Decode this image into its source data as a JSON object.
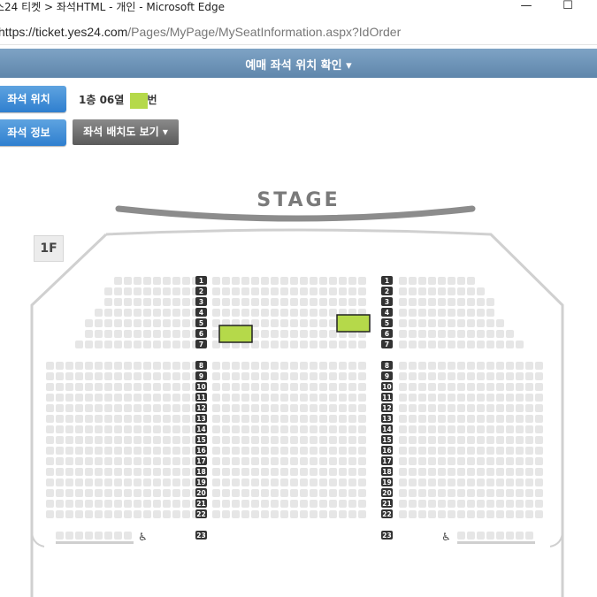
{
  "window": {
    "title": "스24 티켓 > 좌석HTML - 개인 - Microsoft Edge",
    "minimize_glyph": "—",
    "maximize_glyph": "☐"
  },
  "address": {
    "url_host": "https://ticket.yes24.com",
    "url_path": "/Pages/MyPage/MySeatInformation.aspx?IdOrder"
  },
  "header": {
    "title": "예매 좌석 위치 확인 ▾"
  },
  "buttons": {
    "seat_location": "좌석 위치",
    "seat_info": "좌석 정보",
    "seat_map": "좌석 배치도 보기 ▾"
  },
  "seat": {
    "floor_row": "1층 06열",
    "suffix": "번"
  },
  "map": {
    "stage_label": "STAGE",
    "floor_label": "1F",
    "row_numbers_upper": [
      "1",
      "2",
      "3",
      "4",
      "5",
      "6",
      "7"
    ],
    "row_numbers_lower": [
      "8",
      "9",
      "10",
      "11",
      "12",
      "13",
      "14",
      "15",
      "16",
      "17",
      "18",
      "19",
      "20",
      "21",
      "22"
    ],
    "row_number_last": "23",
    "wheelchair_icon": "wheelchair-icon",
    "colors": {
      "seat": "#e6e6e6",
      "highlight": "#b5d94a",
      "badge": "#333333",
      "outline": "#d0d0d0"
    },
    "highlighted_seats": [
      {
        "row": 6,
        "block": "left-center"
      },
      {
        "row": 5,
        "block": "right-center"
      }
    ]
  }
}
